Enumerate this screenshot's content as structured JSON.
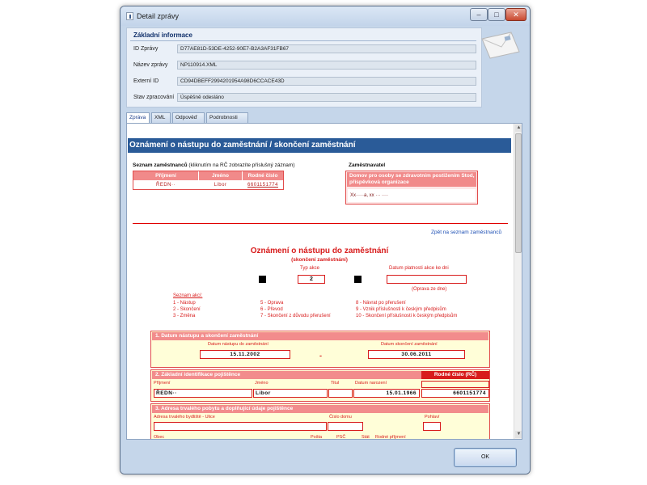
{
  "window": {
    "title": "Detail zprávy",
    "buttons": {
      "minimize": "–",
      "maximize": "□",
      "close": "✕"
    }
  },
  "info": {
    "title": "Základní informace",
    "rows": [
      {
        "label": "ID Zprávy",
        "value": "D77AE81D-53DE-4252-90E7-B2A3AF31FB67"
      },
      {
        "label": "Název zprávy",
        "value": "NP110914.XML"
      },
      {
        "label": "Externí ID",
        "value": "CD94DBEFF2994201954A98D6CCACE43D"
      },
      {
        "label": "Stav zpracování",
        "value": "Úspěšně odesláno"
      }
    ]
  },
  "tabs": [
    {
      "label": "Zpráva",
      "active": true
    },
    {
      "label": "XML",
      "active": false
    },
    {
      "label": "Odpověď",
      "active": false
    },
    {
      "label": "Podrobnosti",
      "active": false
    }
  ],
  "document": {
    "header": "Oznámení o nástupu do zaměstnání / skončení zaměstnání",
    "employees_label": "Seznam zaměstnanců",
    "employees_hint": "(kliknutím na RČ zobrazíte příslušný záznam)",
    "employees_columns": [
      "Příjmení",
      "Jméno",
      "Rodné číslo"
    ],
    "employees_rows": [
      [
        "ŘEDN··",
        "Libor",
        "6601151774"
      ]
    ],
    "employer_label": "Zaměstnavatel",
    "employer_name": "Domov pro osoby se zdravotním postižením Stod, příspěvková organizace",
    "employer_address": "Xx·····a, xx ··· ····",
    "back_link": "Zpět na seznam zaměstnanců",
    "form_title": "Oznámení o nástupu do zaměstnání",
    "form_subtitle": "(skončení zaměstnání)",
    "action_type_label": "Typ akce",
    "action_type_value": "2",
    "action_date_label": "Datum platnosti akce ke dni",
    "correction_label": "(Oprava ze dne)",
    "actions_title": "Seznam akcí:",
    "actions_col1": [
      "1 - Nástup",
      "2 - Skončení",
      "3 - Změna"
    ],
    "actions_col2": [
      "5 - Oprava",
      "6 - Převod",
      "7 - Skončení z důvodu přerušení"
    ],
    "actions_col3": [
      "8 - Návrat po přerušení",
      "9 - Vznik příslušnosti k českým předpisům",
      "10 - Skončení příslušnosti k českým předpisům"
    ],
    "section1": {
      "title": "1. Datum nástupu a skončení zaměstnání",
      "start_label": "Datum nástupu do zaměstnání",
      "start_value": "15.11.2002",
      "end_label": "Datum skončení zaměstnání",
      "end_value": "30.06.2011",
      "dash": "-"
    },
    "section2": {
      "title": "2. Základní identifikace pojištěnce",
      "rc_head": "Rodné číslo (RČ)",
      "labels": [
        "Příjmení",
        "Jméno",
        "Titul",
        "Datum narození"
      ],
      "surname": "ŘEDN··",
      "first_name": "Libor",
      "birth_date": "15.01.1966",
      "rc_value": "6601151774"
    },
    "section3": {
      "title": "3. Adresa trvalého pobytu a doplňující údaje pojištěnce",
      "street_label": "Adresa trvalého bydliště - Ulice",
      "house_label": "Číslo domu",
      "gender_label": "Pohlaví",
      "labels_row2": [
        "Obec",
        "Pošta",
        "PSČ",
        "Stát",
        "Rodné příjmení"
      ]
    }
  },
  "footer": {
    "ok_label": "OK"
  },
  "colors": {
    "accent": "#2a5b98",
    "red": "#d81c1c",
    "pink": "#f18a8a",
    "form_bg": "#fffed8"
  }
}
